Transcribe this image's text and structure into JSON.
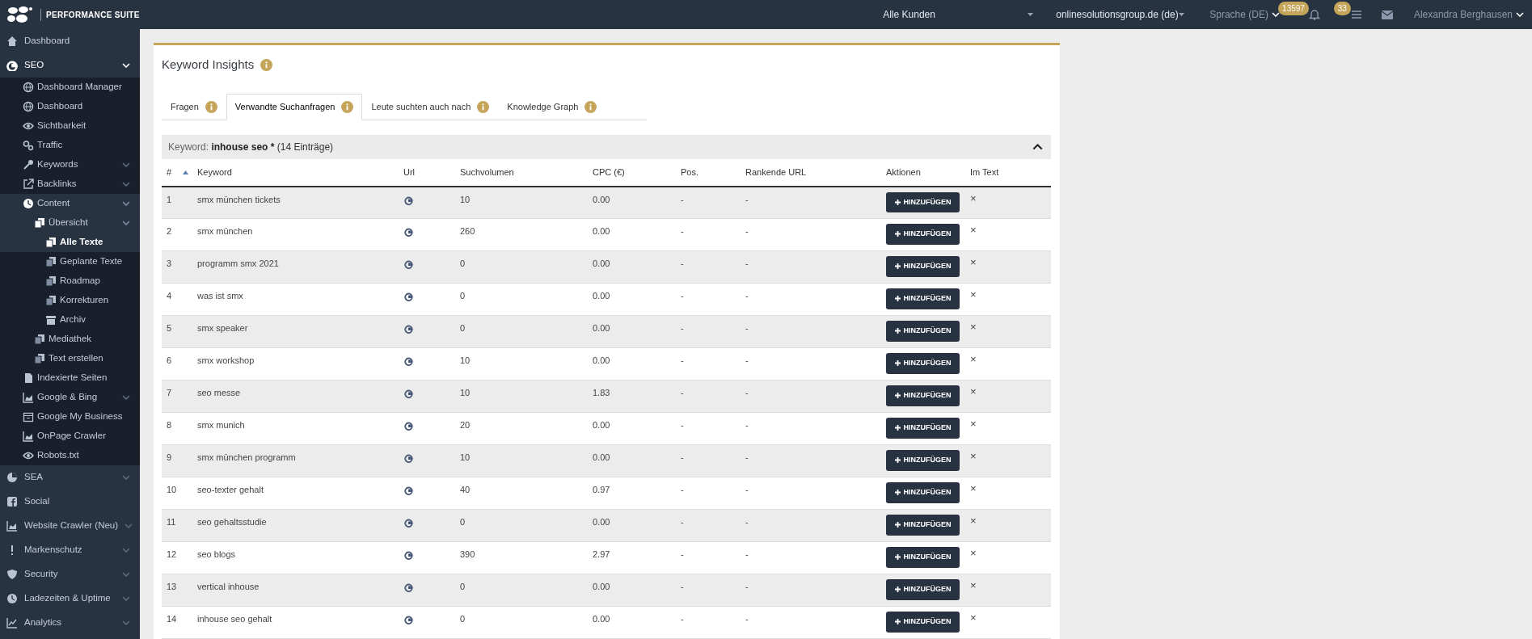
{
  "topbar": {
    "logo_title": "PERFORMANCE SUITE",
    "customer_select": "Alle Kunden",
    "domain_select": "onlinesolutionsgroup.de (de)",
    "language": "Sprache (DE)",
    "notifications_badge": "13597",
    "tasks_badge": "33",
    "user": "Alexandra Berghausen"
  },
  "sidebar": {
    "items": [
      {
        "label": "Dashboard",
        "kind": "link",
        "selected": false
      },
      {
        "label": "SEO",
        "kind": "menu",
        "expanded": true,
        "selected": false,
        "children": [
          {
            "label": "Dashboard Manager",
            "kind": "link",
            "selected": false
          },
          {
            "label": "Dashboard",
            "kind": "link",
            "selected": false
          },
          {
            "label": "Sichtbarkeit",
            "kind": "link",
            "selected": false
          },
          {
            "label": "Traffic",
            "kind": "link",
            "selected": false
          },
          {
            "label": "Keywords",
            "kind": "menu",
            "expanded": false,
            "selected": false
          },
          {
            "label": "Backlinks",
            "kind": "menu",
            "expanded": false,
            "selected": false
          },
          {
            "label": "Content",
            "kind": "menu",
            "expanded": true,
            "selected": false,
            "children": [
              {
                "label": "Übersicht",
                "kind": "menu",
                "expanded": true,
                "selected": false,
                "children": [
                  {
                    "label": "Alle Texte",
                    "kind": "link",
                    "selected": true
                  },
                  {
                    "label": "Geplante Texte",
                    "kind": "link",
                    "selected": false
                  },
                  {
                    "label": "Roadmap",
                    "kind": "link",
                    "selected": false
                  },
                  {
                    "label": "Korrekturen",
                    "kind": "link",
                    "selected": false
                  },
                  {
                    "label": "Archiv",
                    "kind": "link",
                    "selected": false
                  }
                ]
              },
              {
                "label": "Mediathek",
                "kind": "link",
                "selected": false
              },
              {
                "label": "Text erstellen",
                "kind": "link",
                "selected": false
              }
            ]
          },
          {
            "label": "Indexierte Seiten",
            "kind": "link",
            "selected": false
          },
          {
            "label": "Google & Bing",
            "kind": "menu",
            "expanded": false,
            "selected": false
          },
          {
            "label": "Google My Business",
            "kind": "link",
            "selected": false
          },
          {
            "label": "OnPage Crawler",
            "kind": "link",
            "selected": false
          },
          {
            "label": "Robots.txt",
            "kind": "link",
            "selected": false
          }
        ]
      },
      {
        "label": "SEA",
        "kind": "menu",
        "expanded": false,
        "selected": false
      },
      {
        "label": "Social",
        "kind": "link",
        "selected": false
      },
      {
        "label": "Website Crawler (Neu)",
        "kind": "menu",
        "expanded": false,
        "selected": false
      },
      {
        "label": "Markenschutz",
        "kind": "menu",
        "expanded": false,
        "selected": false
      },
      {
        "label": "Security",
        "kind": "menu",
        "expanded": false,
        "selected": false
      },
      {
        "label": "Ladezeiten & Uptime",
        "kind": "menu",
        "expanded": false,
        "selected": false
      },
      {
        "label": "Analytics",
        "kind": "menu",
        "expanded": false,
        "selected": false
      }
    ]
  },
  "panel": {
    "title": "Keyword Insights",
    "tabs": [
      {
        "label": "Fragen",
        "selected": false
      },
      {
        "label": "Verwandte Suchanfragen",
        "selected": true
      },
      {
        "label": "Leute suchten auch nach",
        "selected": false
      },
      {
        "label": "Knowledge Graph",
        "selected": false
      }
    ],
    "keyword_bar": {
      "label": "Keyword:",
      "keyword": "inhouse seo *",
      "count": "(14 Einträge)",
      "expanded": true
    },
    "table": {
      "columns": [
        {
          "label": "#",
          "sorted_ascending": true
        },
        {
          "label": "Keyword"
        },
        {
          "label": "Url"
        },
        {
          "label": "Suchvolumen"
        },
        {
          "label": "CPC (€)"
        },
        {
          "label": "Pos."
        },
        {
          "label": "Rankende URL"
        },
        {
          "label": "Aktionen"
        },
        {
          "label": "Im Text"
        }
      ],
      "rows": [
        {
          "number": "1",
          "keyword": "smx münchen tickets",
          "volume": "10",
          "cpc": "0.00",
          "pos": "-",
          "ranking_url": "-",
          "action": "HINZUFÜGEN",
          "im_text": "×"
        },
        {
          "number": "2",
          "keyword": "smx münchen",
          "volume": "260",
          "cpc": "0.00",
          "pos": "-",
          "ranking_url": "-",
          "action": "HINZUFÜGEN",
          "im_text": "×"
        },
        {
          "number": "3",
          "keyword": "programm smx 2021",
          "volume": "0",
          "cpc": "0.00",
          "pos": "-",
          "ranking_url": "-",
          "action": "HINZUFÜGEN",
          "im_text": "×"
        },
        {
          "number": "4",
          "keyword": "was ist smx",
          "volume": "0",
          "cpc": "0.00",
          "pos": "-",
          "ranking_url": "-",
          "action": "HINZUFÜGEN",
          "im_text": "×"
        },
        {
          "number": "5",
          "keyword": "smx speaker",
          "volume": "0",
          "cpc": "0.00",
          "pos": "-",
          "ranking_url": "-",
          "action": "HINZUFÜGEN",
          "im_text": "×"
        },
        {
          "number": "6",
          "keyword": "smx workshop",
          "volume": "10",
          "cpc": "0.00",
          "pos": "-",
          "ranking_url": "-",
          "action": "HINZUFÜGEN",
          "im_text": "×"
        },
        {
          "number": "7",
          "keyword": "seo messe",
          "volume": "10",
          "cpc": "1.83",
          "pos": "-",
          "ranking_url": "-",
          "action": "HINZUFÜGEN",
          "im_text": "×"
        },
        {
          "number": "8",
          "keyword": "smx munich",
          "volume": "20",
          "cpc": "0.00",
          "pos": "-",
          "ranking_url": "-",
          "action": "HINZUFÜGEN",
          "im_text": "×"
        },
        {
          "number": "9",
          "keyword": "smx münchen programm",
          "volume": "10",
          "cpc": "0.00",
          "pos": "-",
          "ranking_url": "-",
          "action": "HINZUFÜGEN",
          "im_text": "×"
        },
        {
          "number": "10",
          "keyword": "seo-texter gehalt",
          "volume": "40",
          "cpc": "0.97",
          "pos": "-",
          "ranking_url": "-",
          "action": "HINZUFÜGEN",
          "im_text": "×"
        },
        {
          "number": "11",
          "keyword": "seo gehaltsstudie",
          "volume": "0",
          "cpc": "0.00",
          "pos": "-",
          "ranking_url": "-",
          "action": "HINZUFÜGEN",
          "im_text": "×"
        },
        {
          "number": "12",
          "keyword": "seo blogs",
          "volume": "390",
          "cpc": "2.97",
          "pos": "-",
          "ranking_url": "-",
          "action": "HINZUFÜGEN",
          "im_text": "×"
        },
        {
          "number": "13",
          "keyword": "vertical inhouse",
          "volume": "0",
          "cpc": "0.00",
          "pos": "-",
          "ranking_url": "-",
          "action": "HINZUFÜGEN",
          "im_text": "×"
        },
        {
          "number": "14",
          "keyword": "inhouse seo gehalt",
          "volume": "0",
          "cpc": "0.00",
          "pos": "-",
          "ranking_url": "-",
          "action": "HINZUFÜGEN",
          "im_text": "×"
        }
      ]
    }
  }
}
